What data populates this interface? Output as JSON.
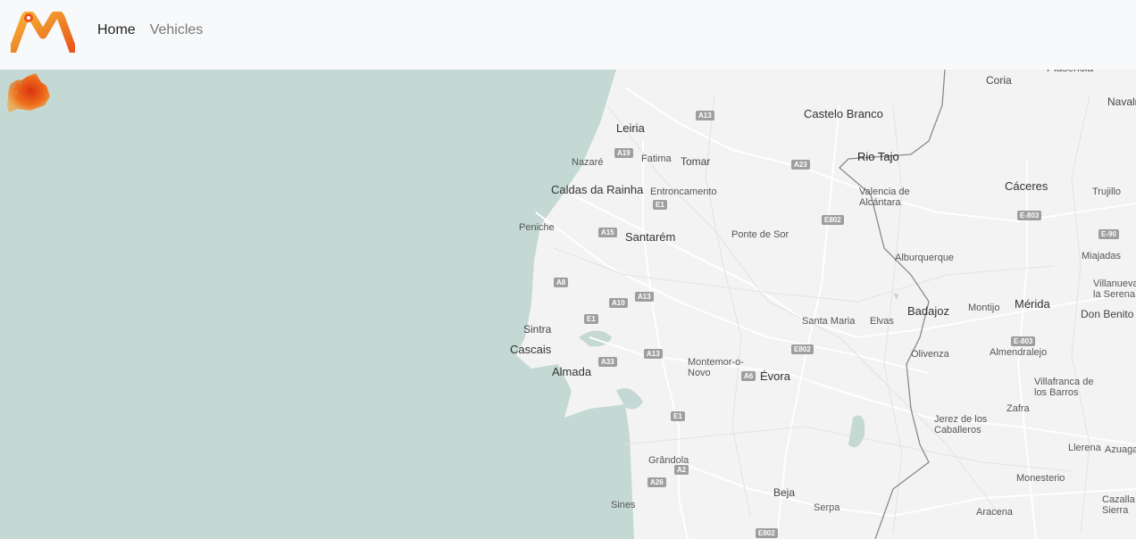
{
  "navbar": {
    "logo_icon": "m-logo-icon",
    "links": [
      {
        "label": "Home",
        "active": true
      },
      {
        "label": "Vehicles",
        "active": false
      }
    ]
  },
  "colors": {
    "navbar_bg": "#f8f9fa",
    "sea": "#c4d9d4",
    "land": "#f3f3f3",
    "logo_orange": "#f08a1c",
    "heat_red": "#e03a10"
  },
  "map": {
    "river_label": "Rio Tajo",
    "places": [
      {
        "name": "Plasencia",
        "cls": "lbl"
      },
      {
        "name": "Coria",
        "cls": "lbl"
      },
      {
        "name": "Navalmoral de la",
        "cls": "lbl"
      },
      {
        "name": "Leiria",
        "cls": "lbl big"
      },
      {
        "name": "Castelo Branco",
        "cls": "lbl big"
      },
      {
        "name": "Nazaré",
        "cls": "lbl sm"
      },
      {
        "name": "Fatima",
        "cls": "lbl sm"
      },
      {
        "name": "Tomar",
        "cls": "lbl"
      },
      {
        "name": "Caldas da Rainha",
        "cls": "lbl big"
      },
      {
        "name": "Entroncamento",
        "cls": "lbl sm"
      },
      {
        "name": "Valencia de Alcántara",
        "cls": "lbl sm"
      },
      {
        "name": "Cáceres",
        "cls": "lbl big"
      },
      {
        "name": "Trujillo",
        "cls": "lbl sm"
      },
      {
        "name": "Peniche",
        "cls": "lbl sm"
      },
      {
        "name": "Santarém",
        "cls": "lbl big"
      },
      {
        "name": "Ponte de Sor",
        "cls": "lbl sm"
      },
      {
        "name": "Alburquerque",
        "cls": "lbl sm"
      },
      {
        "name": "Miajadas",
        "cls": "lbl sm"
      },
      {
        "name": "Villanueva de la Serena",
        "cls": "lbl sm"
      },
      {
        "name": "Montijo",
        "cls": "lbl sm"
      },
      {
        "name": "Mérida",
        "cls": "lbl big"
      },
      {
        "name": "Badajoz",
        "cls": "lbl big"
      },
      {
        "name": "Don Benito",
        "cls": "lbl"
      },
      {
        "name": "Sintra",
        "cls": "lbl"
      },
      {
        "name": "Santa Maria",
        "cls": "lbl sm"
      },
      {
        "name": "Elvas",
        "cls": "lbl sm"
      },
      {
        "name": "Cascais",
        "cls": "lbl big"
      },
      {
        "name": "Olivenza",
        "cls": "lbl sm"
      },
      {
        "name": "Almendralejo",
        "cls": "lbl sm"
      },
      {
        "name": "Almada",
        "cls": "lbl big"
      },
      {
        "name": "Montemor-o-Novo",
        "cls": "lbl sm"
      },
      {
        "name": "Évora",
        "cls": "lbl big"
      },
      {
        "name": "Villafranca de los Barros",
        "cls": "lbl sm"
      },
      {
        "name": "Zafra",
        "cls": "lbl sm"
      },
      {
        "name": "Jerez de los Caballeros",
        "cls": "lbl sm"
      },
      {
        "name": "Llerena",
        "cls": "lbl sm"
      },
      {
        "name": "Azuaga",
        "cls": "lbl sm"
      },
      {
        "name": "Grândola",
        "cls": "lbl sm"
      },
      {
        "name": "Monesterio",
        "cls": "lbl sm"
      },
      {
        "name": "Beja",
        "cls": "lbl"
      },
      {
        "name": "Serpa",
        "cls": "lbl sm"
      },
      {
        "name": "Sines",
        "cls": "lbl sm"
      },
      {
        "name": "Aracena",
        "cls": "lbl sm"
      },
      {
        "name": "Cazalla de la Sierra",
        "cls": "lbl sm"
      }
    ],
    "shields": [
      "A13",
      "A19",
      "A23",
      "E1",
      "E802",
      "E-803",
      "A15",
      "E-90",
      "A8",
      "A13",
      "A10",
      "E1",
      "A13",
      "E-803",
      "A33",
      "E802",
      "A6",
      "E1",
      "A2",
      "A26",
      "E802"
    ]
  }
}
